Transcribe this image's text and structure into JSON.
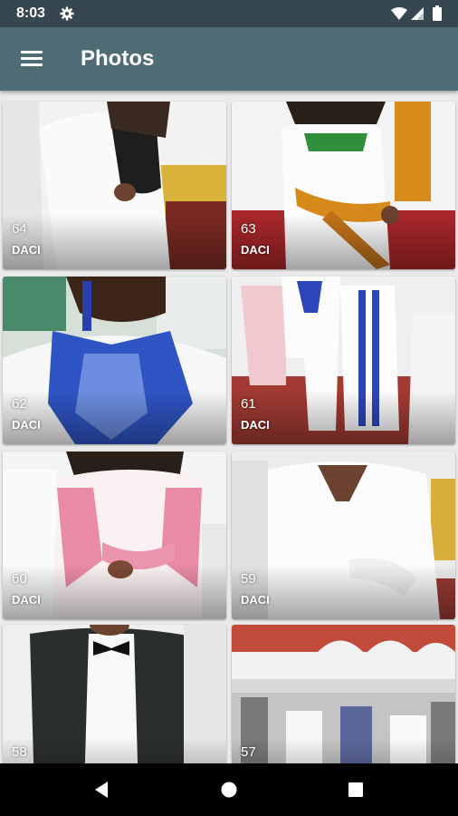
{
  "status_bar": {
    "time": "8:03",
    "icons": [
      "gear-icon",
      "wifi-icon",
      "signal-icon",
      "battery-icon"
    ]
  },
  "app_bar": {
    "title": "Photos",
    "menu_icon": "hamburger-menu-icon"
  },
  "photos": [
    {
      "number": "64",
      "caption": "DACI",
      "scene": "woman in white outfit with black top, dancing"
    },
    {
      "number": "63",
      "caption": "DACI",
      "scene": "woman in white dress with kente sash"
    },
    {
      "number": "62",
      "caption": "DACI",
      "scene": "white outfit with blue embroidered collar"
    },
    {
      "number": "61",
      "caption": "DACI",
      "scene": "group dancing in white and blue outfits"
    },
    {
      "number": "60",
      "caption": "DACI",
      "scene": "woman in white and pink lace outfit"
    },
    {
      "number": "59",
      "caption": "DACI",
      "scene": "woman in white wrap dress"
    },
    {
      "number": "58",
      "caption": "",
      "scene": "man in black suit with bow tie"
    },
    {
      "number": "57",
      "caption": "",
      "scene": "crowded hall with red arches"
    }
  ],
  "nav_bar": {
    "icons": [
      "back-icon",
      "home-icon",
      "recents-icon"
    ]
  },
  "colors": {
    "status_bar": "#37474f",
    "app_bar": "#4f6b74",
    "background": "#eaeaea",
    "nav_bar": "#000000"
  }
}
